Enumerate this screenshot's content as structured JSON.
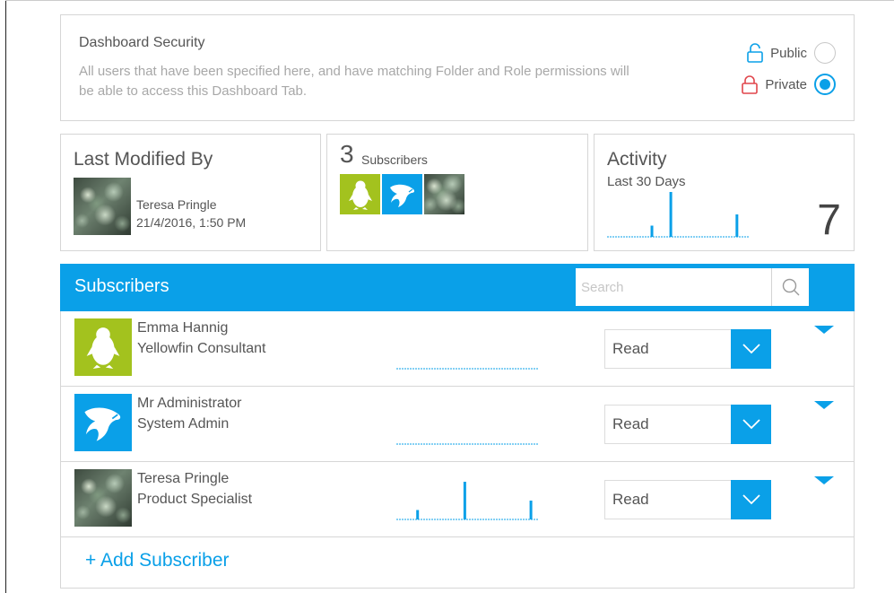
{
  "security": {
    "title": "Dashboard Security",
    "description": "All users that have been specified here, and have matching Folder and Role permissions will be able to access this Dashboard Tab.",
    "options": [
      {
        "label": "Public",
        "selected": false,
        "icon": "unlocked-lock-icon"
      },
      {
        "label": "Private",
        "selected": true,
        "icon": "locked-lock-icon"
      }
    ]
  },
  "last_modified": {
    "title": "Last Modified By",
    "user": "Teresa Pringle",
    "date": "21/4/2016, 1:50 PM"
  },
  "subscribers_summary": {
    "count": "3",
    "label": "Subscribers"
  },
  "activity": {
    "title": "Activity",
    "period": "Last 30 Days",
    "value": "7",
    "sparkline": [
      0,
      0,
      0,
      0,
      0,
      0,
      0,
      0,
      0,
      1,
      0,
      0,
      0,
      4,
      0,
      0,
      0,
      0,
      0,
      0,
      0,
      0,
      0,
      0,
      0,
      0,
      0,
      2,
      0,
      0
    ]
  },
  "subscribers_panel": {
    "title": "Subscribers",
    "search_placeholder": "Search",
    "rows": [
      {
        "name": "Emma Hannig",
        "role": "Yellowfin Consultant",
        "avatar": "penguin-avatar",
        "permission": "Read",
        "activity": [
          0,
          0,
          0,
          0,
          0,
          0,
          0,
          0,
          0,
          0,
          0,
          0,
          0,
          0,
          0,
          0,
          0,
          0,
          0,
          0,
          0,
          0,
          0,
          0,
          0,
          0,
          0,
          0,
          0,
          0
        ]
      },
      {
        "name": "Mr Administrator",
        "role": "System Admin",
        "avatar": "fish-avatar",
        "permission": "Read",
        "activity": [
          0,
          0,
          0,
          0,
          0,
          0,
          0,
          0,
          0,
          0,
          0,
          0,
          0,
          0,
          0,
          0,
          0,
          0,
          0,
          0,
          0,
          0,
          0,
          0,
          0,
          0,
          0,
          0,
          0,
          0
        ]
      },
      {
        "name": "Teresa Pringle",
        "role": "Product Specialist",
        "avatar": "photo-avatar",
        "permission": "Read",
        "activity": [
          0,
          0,
          0,
          0,
          1,
          0,
          0,
          0,
          0,
          0,
          0,
          0,
          0,
          0,
          4,
          0,
          0,
          0,
          0,
          0,
          0,
          0,
          0,
          0,
          0,
          0,
          0,
          0,
          2,
          0
        ]
      }
    ],
    "add_label": "+ Add Subscriber"
  },
  "colors": {
    "accent": "#0aa0e8",
    "penguin_bg": "#a3c21e",
    "private_lock": "#e0454b"
  }
}
